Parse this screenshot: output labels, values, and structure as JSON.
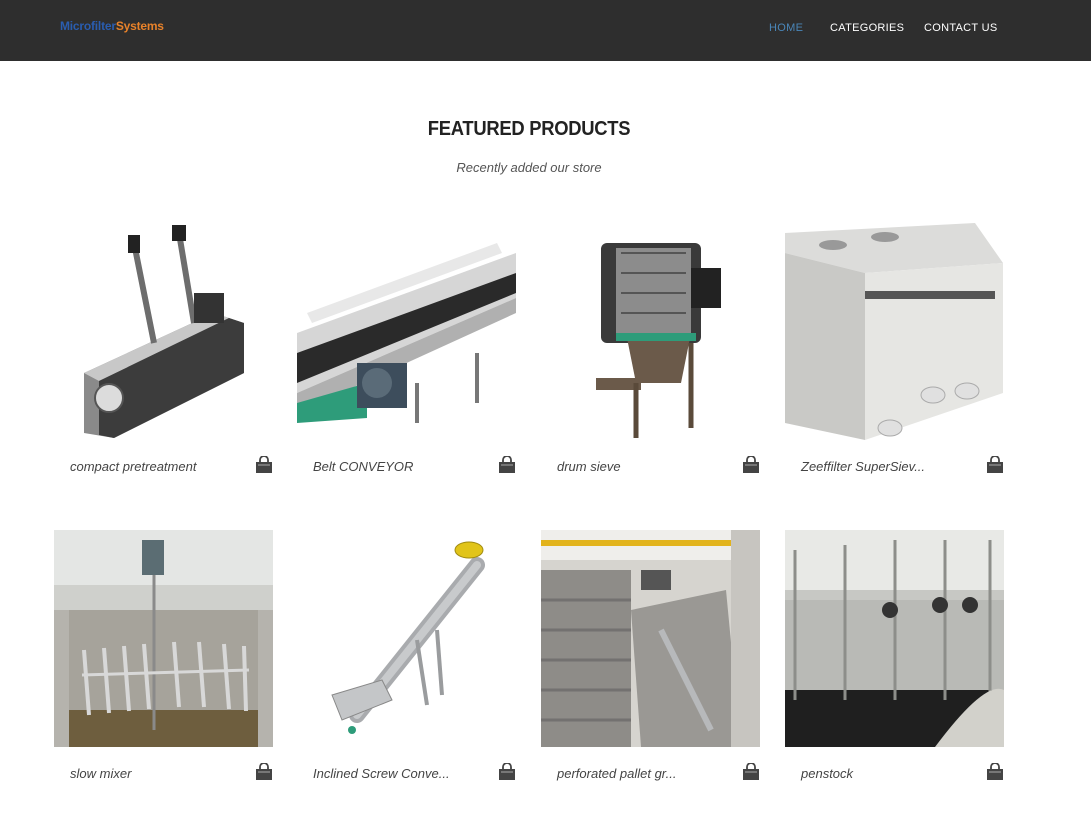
{
  "brand": {
    "part1": "Microfilter",
    "part2": "Systems"
  },
  "nav": {
    "home": "HOME",
    "categories": "CATEGORIES",
    "contact": "CONTACT US"
  },
  "section": {
    "title": "FEATURED PRODUCTS",
    "subtitle": "Recently added our store"
  },
  "products": [
    {
      "name": "compact pretreatment",
      "image": "compact-pretreatment-image"
    },
    {
      "name": "Belt CONVEYOR",
      "image": "belt-conveyor-image"
    },
    {
      "name": "drum sieve",
      "image": "drum-sieve-image"
    },
    {
      "name": "Zeeffilter SuperSiev...",
      "image": "zeeffilter-image"
    },
    {
      "name": "slow mixer",
      "image": "slow-mixer-image"
    },
    {
      "name": "Inclined Screw Conve...",
      "image": "inclined-screw-conveyor-image"
    },
    {
      "name": "perforated pallet gr...",
      "image": "perforated-pallet-grid-image"
    },
    {
      "name": "penstock",
      "image": "penstock-image"
    }
  ],
  "icons": {
    "cart": "shopping-bag-icon"
  },
  "colors": {
    "navbar": "#2e2e2e",
    "nav_active": "#4a86b8",
    "brand_blue": "#2a5db0",
    "brand_orange": "#e8822a"
  }
}
